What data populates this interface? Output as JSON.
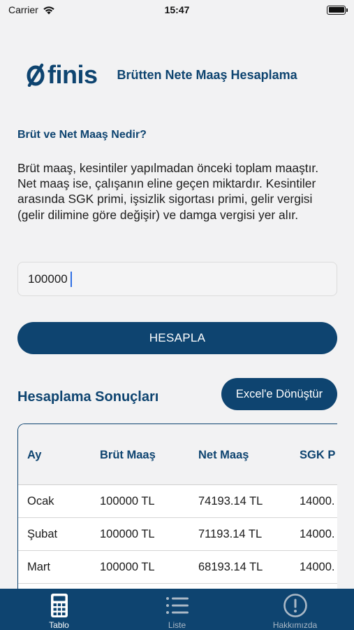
{
  "status_bar": {
    "carrier": "Carrier",
    "time": "15:47"
  },
  "header": {
    "logo_text": "finis",
    "title": "Brütten Nete Maaş Hesaplama"
  },
  "info": {
    "heading": "Brüt ve Net Maaş Nedir?",
    "text": "Brüt maaş, kesintiler yapılmadan önceki toplam maaştır. Net maaş ise, çalışanın eline geçen miktardır. Kesintiler arasında SGK primi, işsizlik sigortası primi, gelir vergisi (gelir dilimine göre değişir) ve damga vergisi yer alır."
  },
  "form": {
    "amount_value": "100000",
    "calculate_label": "HESAPLA"
  },
  "results": {
    "title": "Hesaplama Sonuçları",
    "export_label": "Excel'e Dönüştür",
    "columns": [
      "Ay",
      "Brüt Maaş",
      "Net Maaş",
      "SGK P"
    ],
    "rows": [
      {
        "month": "Ocak",
        "gross": "100000 TL",
        "net": "74193.14 TL",
        "sgk": "14000."
      },
      {
        "month": "Şubat",
        "gross": "100000 TL",
        "net": "71193.14 TL",
        "sgk": "14000."
      },
      {
        "month": "Mart",
        "gross": "100000 TL",
        "net": "68193.14 TL",
        "sgk": "14000."
      }
    ]
  },
  "tabs": [
    {
      "label": "Tablo",
      "icon": "calculator-icon",
      "active": true
    },
    {
      "label": "Liste",
      "icon": "list-icon",
      "active": false
    },
    {
      "label": "Hakkımızda",
      "icon": "info-icon",
      "active": false
    }
  ],
  "colors": {
    "primary": "#0e4470",
    "background": "#f2f2f3"
  }
}
